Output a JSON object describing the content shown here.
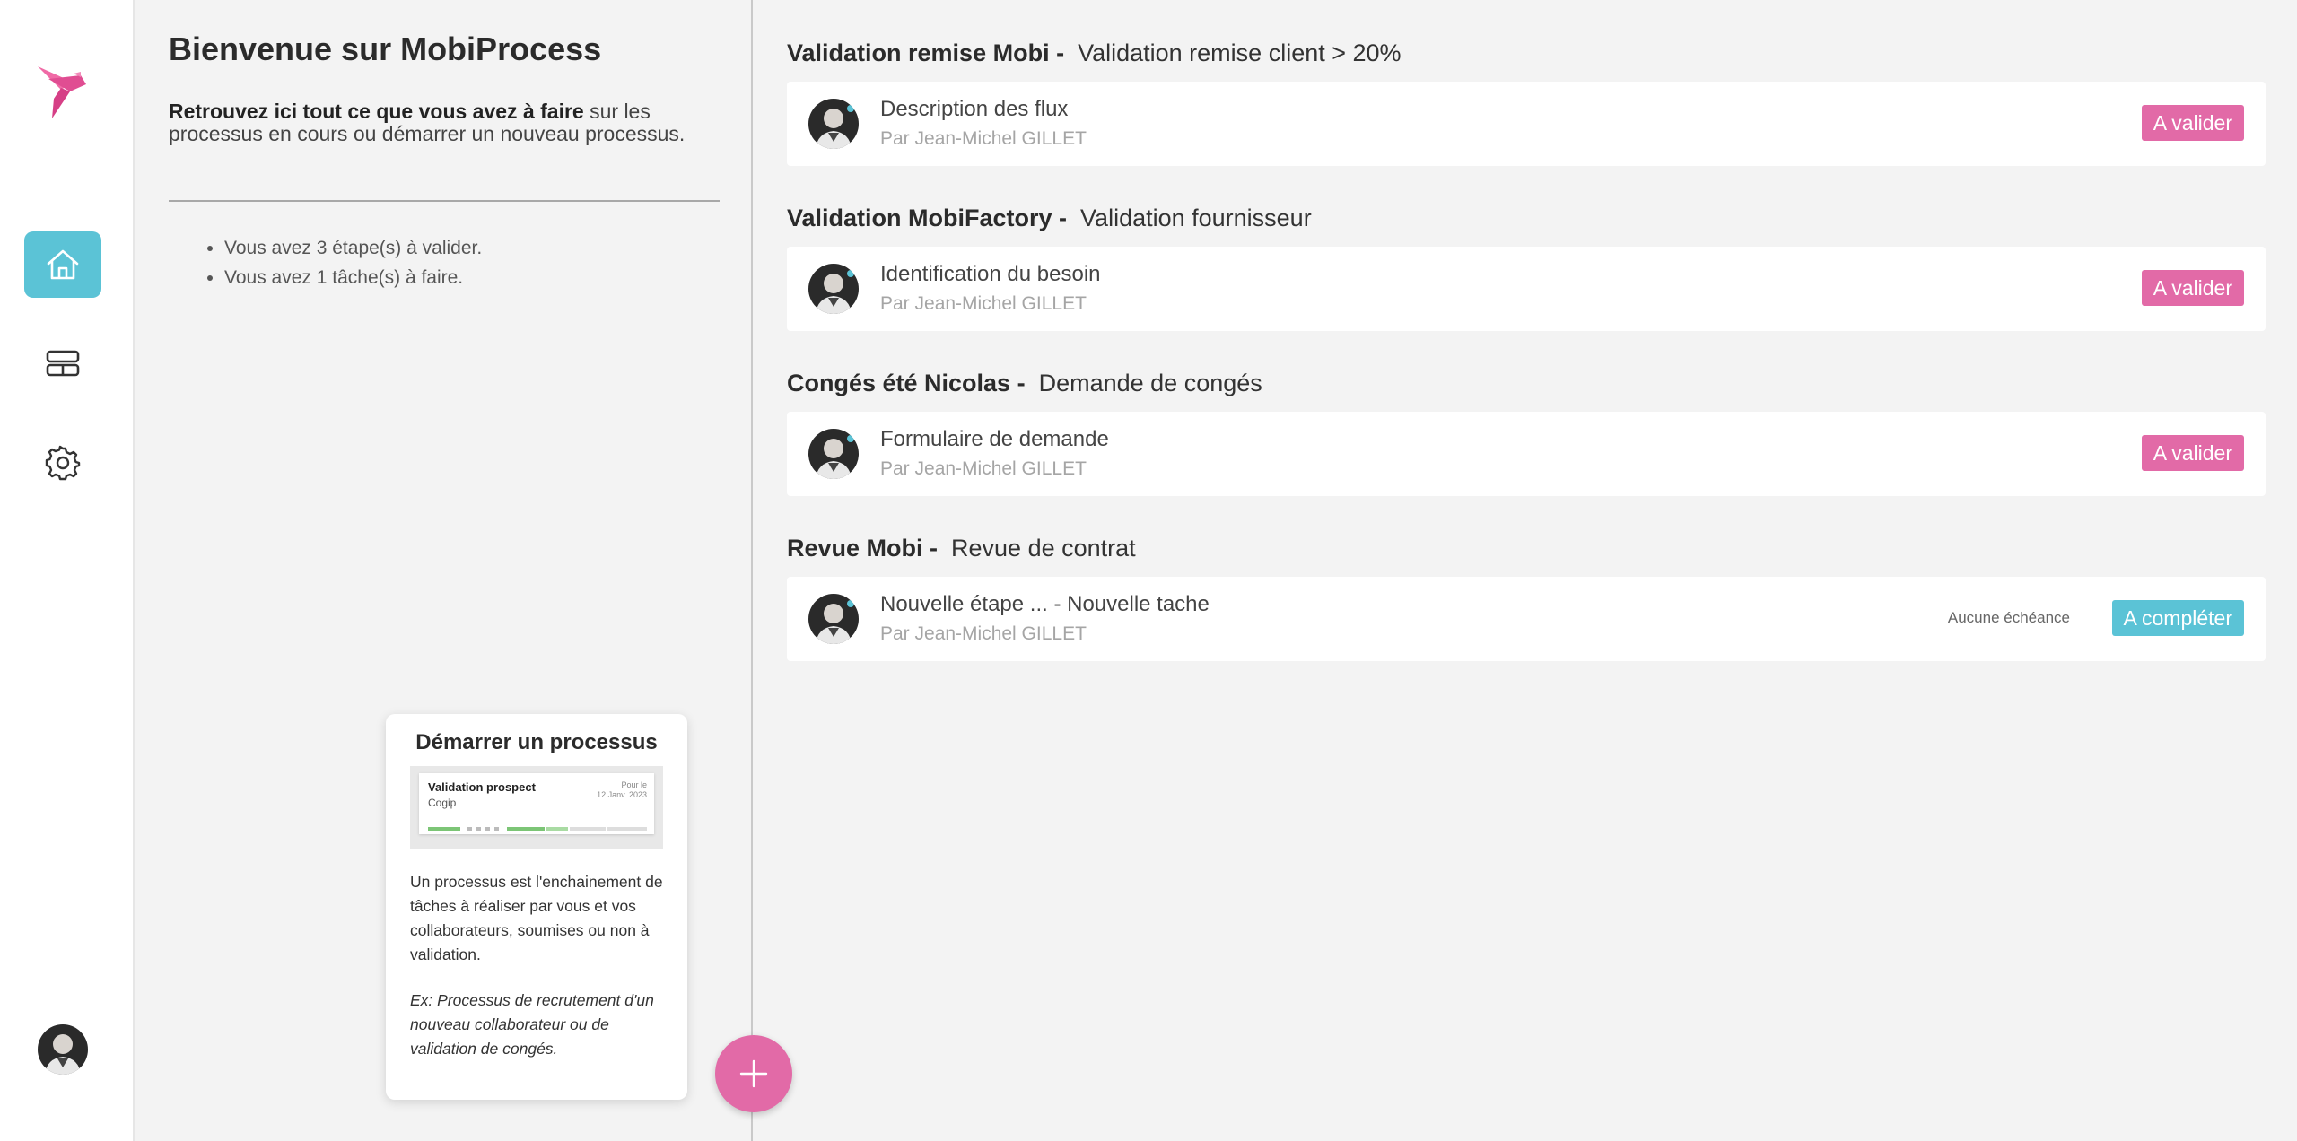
{
  "colors": {
    "accent_pink": "#e26aa7",
    "accent_teal": "#5bc3d6"
  },
  "nav": {
    "icons": [
      "bird-logo-icon",
      "home-icon",
      "processes-icon",
      "gear-icon",
      "user-avatar"
    ]
  },
  "welcome": {
    "title": "Bienvenue sur MobiProcess",
    "intro_bold": "Retrouvez ici tout ce que vous avez à faire",
    "intro_rest": " sur les processus en cours ou démarrer un nouveau processus.",
    "todo": [
      "Vous avez 3 étape(s) à valider.",
      "Vous avez 1 tâche(s) à faire."
    ]
  },
  "start_card": {
    "title": "Démarrer un processus",
    "mini_title": "Validation prospect",
    "mini_sub": "Cogip",
    "mini_date_label": "Pour le",
    "mini_date": "12 Janv. 2023",
    "description": "Un processus est l'enchainement de tâches à réaliser par vous et vos collaborateurs, soumises ou non à validation.",
    "example": "Ex: Processus de recrutement d'un nouveau collaborateur ou de validation de congés."
  },
  "processes": [
    {
      "name": "Validation remise Mobi -",
      "subtitle": "Validation remise client > 20%",
      "task": "Description des flux",
      "by": "Par Jean-Michel GILLET",
      "action": "A valider",
      "deadline": ""
    },
    {
      "name": "Validation MobiFactory -",
      "subtitle": "Validation fournisseur",
      "task": "Identification du besoin",
      "by": "Par Jean-Michel GILLET",
      "action": "A valider",
      "deadline": ""
    },
    {
      "name": "Congés été Nicolas -",
      "subtitle": "Demande de congés",
      "task": "Formulaire de demande",
      "by": "Par Jean-Michel GILLET",
      "action": "A valider",
      "deadline": ""
    },
    {
      "name": "Revue Mobi -",
      "subtitle": "Revue de contrat",
      "task": "Nouvelle étape ... - Nouvelle tache",
      "by": "Par Jean-Michel GILLET",
      "action": "A compléter",
      "deadline": "Aucune échéance"
    }
  ]
}
